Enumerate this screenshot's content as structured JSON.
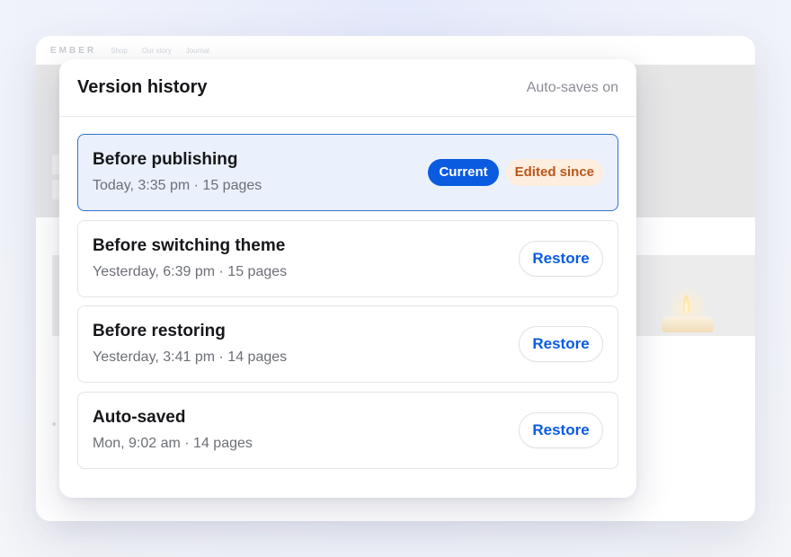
{
  "background_site": {
    "logo": "EMBER",
    "nav_links": [
      "Shop",
      "Our story",
      "Journal"
    ]
  },
  "dialog": {
    "title": "Version history",
    "status": "Auto-saves on"
  },
  "versions": [
    {
      "name": "Before publishing",
      "meta": "Today, 3:35 pm · 15 pages",
      "current": true,
      "badges": [
        "Current",
        "Edited since"
      ]
    },
    {
      "name": "Before switching theme",
      "meta": "Yesterday, 6:39 pm · 15 pages",
      "action_label": "Restore"
    },
    {
      "name": "Before restoring",
      "meta": "Yesterday, 3:41 pm · 14 pages",
      "action_label": "Restore"
    },
    {
      "name": "Auto-saved",
      "meta": "Mon, 9:02 am · 14 pages",
      "action_label": "Restore"
    }
  ],
  "colors": {
    "accent": "#0a5be0",
    "current_row_bg": "#eaf1fd",
    "edited_badge_bg": "#fdeedf",
    "edited_badge_text": "#b9561b"
  }
}
